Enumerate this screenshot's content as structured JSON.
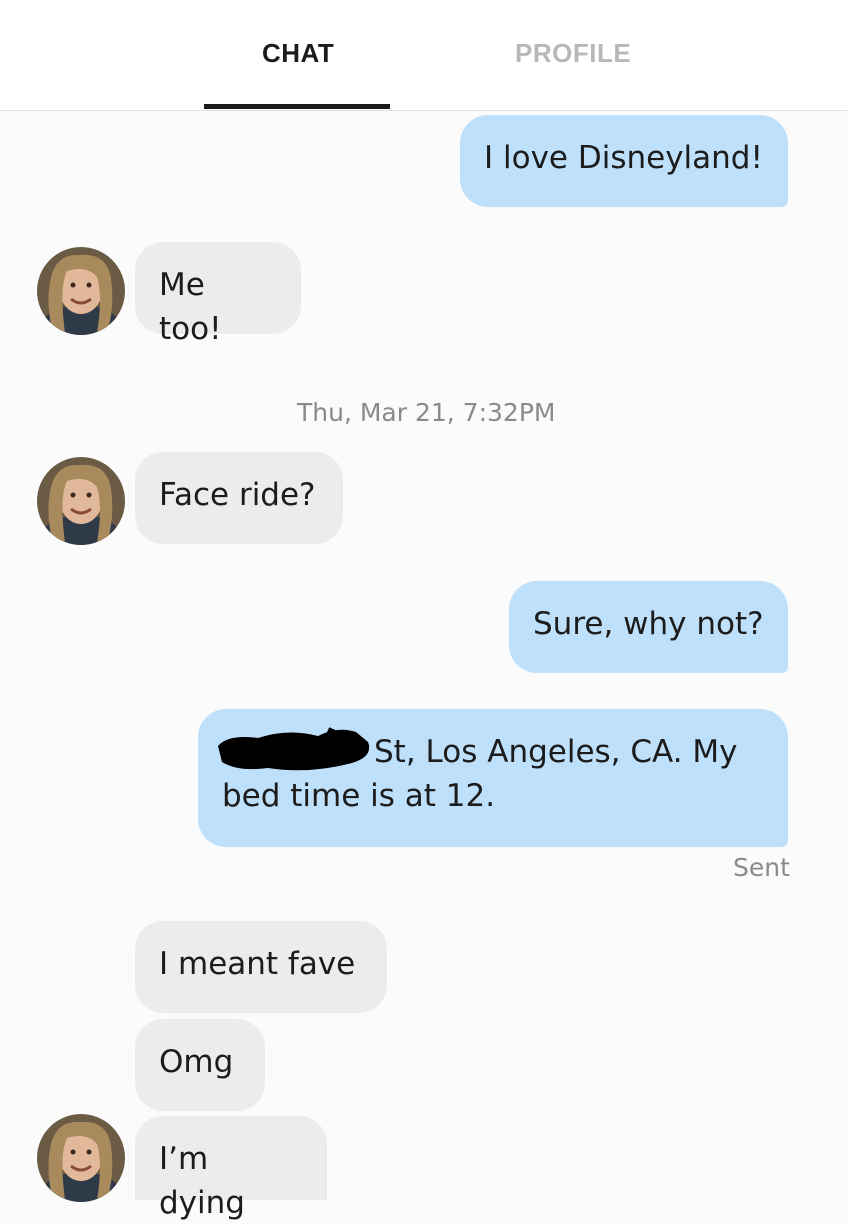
{
  "tabs": {
    "chat": "CHAT",
    "profile": "PROFILE"
  },
  "messages": {
    "m1": "I love Disneyland!",
    "m2": "Me too!",
    "timestamp": "Thu, Mar 21, 7:32PM",
    "m3": "Face ride?",
    "m4": "Sure, why not?",
    "m5_visible": "St, Los Angeles, CA. My",
    "m5_line2": "bed time is at 12.",
    "sent_status": "Sent",
    "m6": "I meant fave",
    "m7": "Omg",
    "m8": "I’m dying"
  },
  "colors": {
    "outgoing_bubble": "#bfe0fa",
    "incoming_bubble": "#ececec",
    "active_tab": "#1c1c1c",
    "inactive_tab": "#b8b8b8",
    "redaction": "#000000"
  },
  "icons": {
    "avatar": "profile-photo-avatar"
  }
}
